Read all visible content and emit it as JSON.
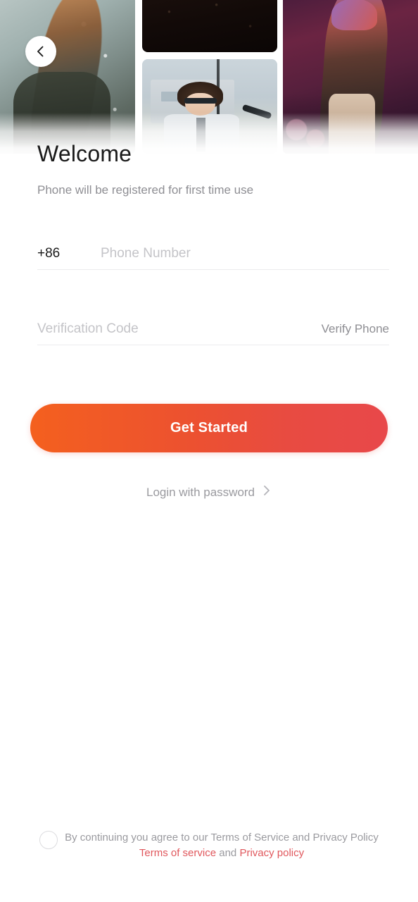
{
  "header": {
    "back_icon": "chevron-left-icon",
    "images": [
      {
        "name": "concert-smoke-photo",
        "alt": "performer in smoke"
      },
      {
        "name": "dark-stage-photo",
        "alt": "dark stage"
      },
      {
        "name": "singer-portrait-photo",
        "alt": "young singer with sunglasses at microphone"
      },
      {
        "name": "concert-purple-photo",
        "alt": "performer under purple stage lights"
      }
    ]
  },
  "page_title": "Welcome",
  "subtitle": "Phone will be registered for first time use",
  "form": {
    "country_code": "+86",
    "phone_placeholder": "Phone Number",
    "phone_value": "",
    "code_placeholder": "Verification Code",
    "code_value": "",
    "verify_button": "Verify Phone"
  },
  "cta": {
    "label": "Get Started",
    "gradient_start": "#f4601e",
    "gradient_end": "#e8484a"
  },
  "login_password": {
    "label": "Login with password",
    "icon": "chevron-right-icon"
  },
  "terms": {
    "checkbox_checked": false,
    "line1": "By continuing you agree to our Terms of Service and Privacy Policy",
    "terms_link": "Terms of service",
    "conjunction": "and",
    "privacy_link": "Privacy policy",
    "link_color": "#e0575c"
  }
}
